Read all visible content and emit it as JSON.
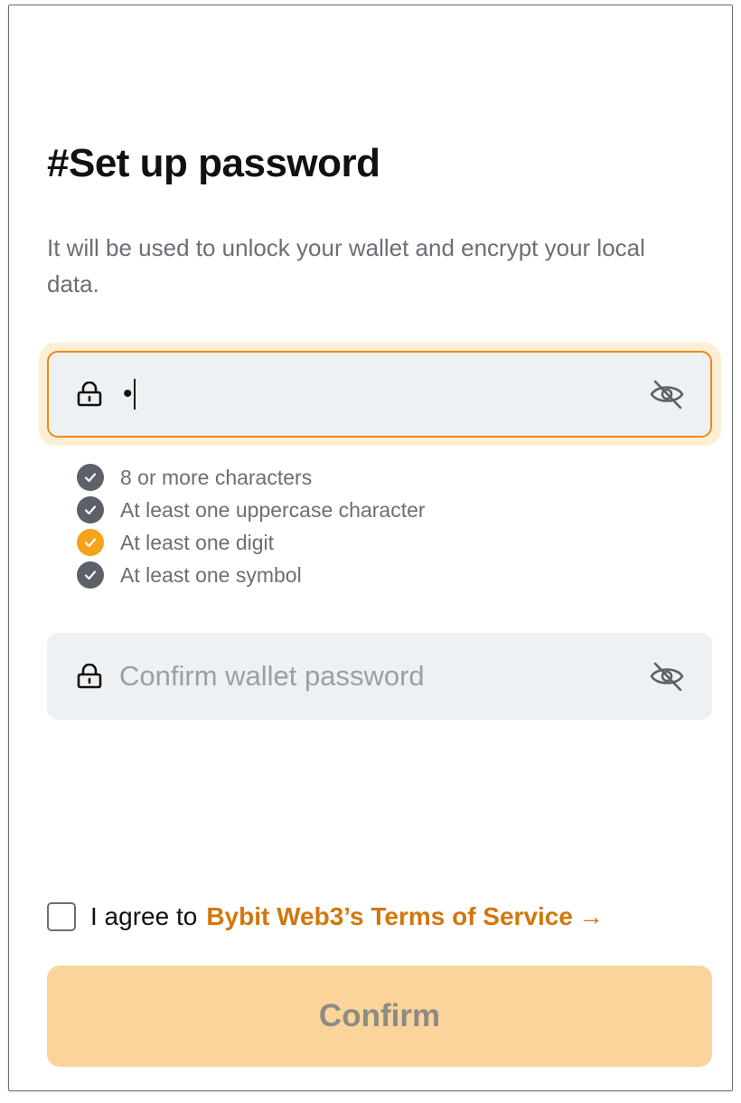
{
  "page": {
    "title": "#Set up password",
    "subtitle": "It will be used to unlock your wallet and encrypt your local data."
  },
  "password_field": {
    "value": "•",
    "lock_icon": "lock-icon",
    "visibility_icon": "eye-off-icon",
    "accent_color": "#ef8a0e"
  },
  "requirements": [
    {
      "label": "8 or more characters",
      "met": false
    },
    {
      "label": "At least one uppercase character",
      "met": false
    },
    {
      "label": "At least one digit",
      "met": true
    },
    {
      "label": "At least one symbol",
      "met": false
    }
  ],
  "confirm_field": {
    "placeholder": "Confirm wallet password",
    "value": "",
    "lock_icon": "lock-icon",
    "visibility_icon": "eye-off-icon"
  },
  "agreement": {
    "prefix": "I agree to",
    "link_text": "Bybit Web3’s Terms of Service",
    "arrow": "→",
    "checked": false,
    "link_color": "#d2770a"
  },
  "confirm_button": {
    "label": "Confirm",
    "enabled": false,
    "background": "#fad49a"
  }
}
